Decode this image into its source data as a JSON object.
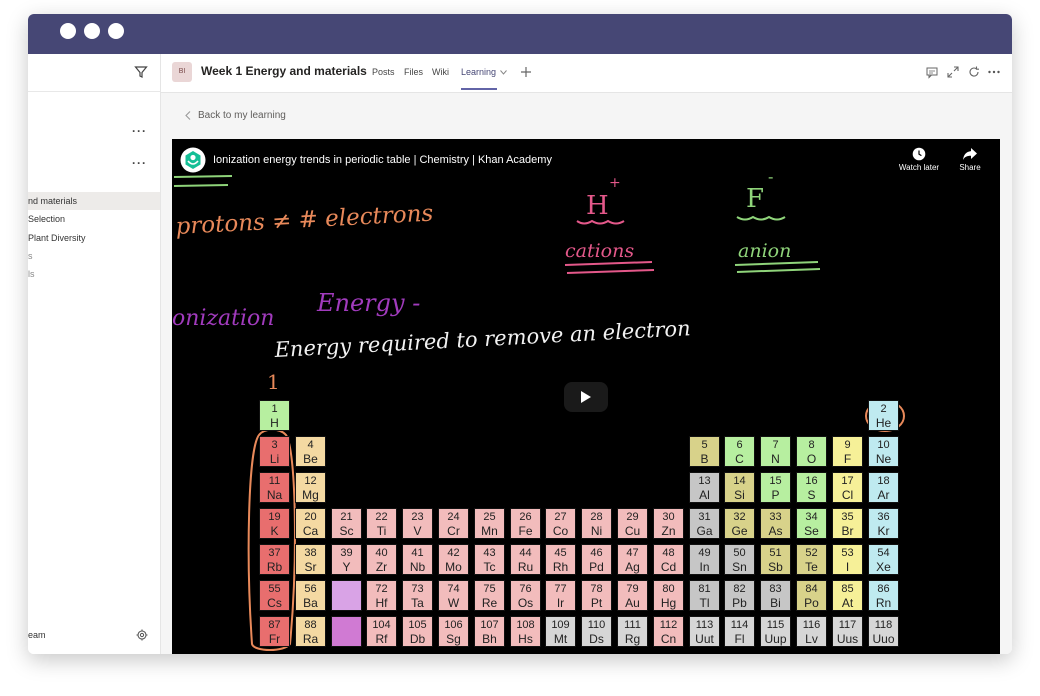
{
  "sidebar": {
    "items": [
      {
        "label": "nd materials",
        "active": true
      },
      {
        "label": "Selection"
      },
      {
        "label": "Plant Diversity"
      },
      {
        "label": "s",
        "faint": true
      },
      {
        "label": "ls",
        "faint": true
      }
    ],
    "footer_label": "eam"
  },
  "header": {
    "team_badge": "BI",
    "title": "Week 1 Energy and materials",
    "tabs": [
      "Posts",
      "Files",
      "Wiki",
      "Learning"
    ],
    "active_tab": "Learning"
  },
  "back_link": "Back to my learning",
  "video": {
    "title": "Ionization energy trends in periodic table | Chemistry | Khan Academy",
    "watch_later": "Watch later",
    "share": "Share",
    "handwriting": {
      "protons": "protons ≠ # electrons",
      "cation_symbol": "H",
      "cation_charge": "+",
      "cation_label": "cations",
      "anion_symbol": "F",
      "anion_charge": "-",
      "anion_label": "anion",
      "ionization_1": "onization",
      "ionization_2": "Energy -",
      "definition": "Energy required to remove an electron",
      "group_number": "1"
    },
    "elements": [
      {
        "n": "1",
        "s": "H",
        "c": "#b7efa0",
        "col": 0,
        "row": 0
      },
      {
        "n": "2",
        "s": "He",
        "c": "#bfeaf0",
        "col": 17,
        "row": 0
      },
      {
        "n": "3",
        "s": "Li",
        "c": "#e86e6e",
        "col": 0,
        "row": 1
      },
      {
        "n": "4",
        "s": "Be",
        "c": "#f4d9a2",
        "col": 1,
        "row": 1
      },
      {
        "n": "5",
        "s": "B",
        "c": "#d8d28a",
        "col": 12,
        "row": 1
      },
      {
        "n": "6",
        "s": "C",
        "c": "#b7efa0",
        "col": 13,
        "row": 1
      },
      {
        "n": "7",
        "s": "N",
        "c": "#b7efa0",
        "col": 14,
        "row": 1
      },
      {
        "n": "8",
        "s": "O",
        "c": "#b7efa0",
        "col": 15,
        "row": 1
      },
      {
        "n": "9",
        "s": "F",
        "c": "#f6f098",
        "col": 16,
        "row": 1
      },
      {
        "n": "10",
        "s": "Ne",
        "c": "#bfeaf0",
        "col": 17,
        "row": 1
      },
      {
        "n": "11",
        "s": "Na",
        "c": "#e86e6e",
        "col": 0,
        "row": 2
      },
      {
        "n": "12",
        "s": "Mg",
        "c": "#f4d9a2",
        "col": 1,
        "row": 2
      },
      {
        "n": "13",
        "s": "Al",
        "c": "#c6c6c6",
        "col": 12,
        "row": 2
      },
      {
        "n": "14",
        "s": "Si",
        "c": "#d8d28a",
        "col": 13,
        "row": 2
      },
      {
        "n": "15",
        "s": "P",
        "c": "#b7efa0",
        "col": 14,
        "row": 2
      },
      {
        "n": "16",
        "s": "S",
        "c": "#b7efa0",
        "col": 15,
        "row": 2
      },
      {
        "n": "17",
        "s": "Cl",
        "c": "#f6f098",
        "col": 16,
        "row": 2
      },
      {
        "n": "18",
        "s": "Ar",
        "c": "#bfeaf0",
        "col": 17,
        "row": 2
      },
      {
        "n": "19",
        "s": "K",
        "c": "#e86e6e",
        "col": 0,
        "row": 3
      },
      {
        "n": "20",
        "s": "Ca",
        "c": "#f4d9a2",
        "col": 1,
        "row": 3
      },
      {
        "n": "21",
        "s": "Sc",
        "c": "#f2bcbc",
        "col": 2,
        "row": 3
      },
      {
        "n": "22",
        "s": "Ti",
        "c": "#f2bcbc",
        "col": 3,
        "row": 3
      },
      {
        "n": "23",
        "s": "V",
        "c": "#f2bcbc",
        "col": 4,
        "row": 3
      },
      {
        "n": "24",
        "s": "Cr",
        "c": "#f2bcbc",
        "col": 5,
        "row": 3
      },
      {
        "n": "25",
        "s": "Mn",
        "c": "#f2bcbc",
        "col": 6,
        "row": 3
      },
      {
        "n": "26",
        "s": "Fe",
        "c": "#f2bcbc",
        "col": 7,
        "row": 3
      },
      {
        "n": "27",
        "s": "Co",
        "c": "#f2bcbc",
        "col": 8,
        "row": 3
      },
      {
        "n": "28",
        "s": "Ni",
        "c": "#f2bcbc",
        "col": 9,
        "row": 3
      },
      {
        "n": "29",
        "s": "Cu",
        "c": "#f2bcbc",
        "col": 10,
        "row": 3
      },
      {
        "n": "30",
        "s": "Zn",
        "c": "#f2bcbc",
        "col": 11,
        "row": 3
      },
      {
        "n": "31",
        "s": "Ga",
        "c": "#c6c6c6",
        "col": 12,
        "row": 3
      },
      {
        "n": "32",
        "s": "Ge",
        "c": "#d8d28a",
        "col": 13,
        "row": 3
      },
      {
        "n": "33",
        "s": "As",
        "c": "#d8d28a",
        "col": 14,
        "row": 3
      },
      {
        "n": "34",
        "s": "Se",
        "c": "#b7efa0",
        "col": 15,
        "row": 3
      },
      {
        "n": "35",
        "s": "Br",
        "c": "#f6f098",
        "col": 16,
        "row": 3
      },
      {
        "n": "36",
        "s": "Kr",
        "c": "#bfeaf0",
        "col": 17,
        "row": 3
      },
      {
        "n": "37",
        "s": "Rb",
        "c": "#e86e6e",
        "col": 0,
        "row": 4
      },
      {
        "n": "38",
        "s": "Sr",
        "c": "#f4d9a2",
        "col": 1,
        "row": 4
      },
      {
        "n": "39",
        "s": "Y",
        "c": "#f2bcbc",
        "col": 2,
        "row": 4
      },
      {
        "n": "40",
        "s": "Zr",
        "c": "#f2bcbc",
        "col": 3,
        "row": 4
      },
      {
        "n": "41",
        "s": "Nb",
        "c": "#f2bcbc",
        "col": 4,
        "row": 4
      },
      {
        "n": "42",
        "s": "Mo",
        "c": "#f2bcbc",
        "col": 5,
        "row": 4
      },
      {
        "n": "43",
        "s": "Tc",
        "c": "#f2bcbc",
        "col": 6,
        "row": 4
      },
      {
        "n": "44",
        "s": "Ru",
        "c": "#f2bcbc",
        "col": 7,
        "row": 4
      },
      {
        "n": "45",
        "s": "Rh",
        "c": "#f2bcbc",
        "col": 8,
        "row": 4
      },
      {
        "n": "46",
        "s": "Pd",
        "c": "#f2bcbc",
        "col": 9,
        "row": 4
      },
      {
        "n": "47",
        "s": "Ag",
        "c": "#f2bcbc",
        "col": 10,
        "row": 4
      },
      {
        "n": "48",
        "s": "Cd",
        "c": "#f2bcbc",
        "col": 11,
        "row": 4
      },
      {
        "n": "49",
        "s": "In",
        "c": "#c6c6c6",
        "col": 12,
        "row": 4
      },
      {
        "n": "50",
        "s": "Sn",
        "c": "#c6c6c6",
        "col": 13,
        "row": 4
      },
      {
        "n": "51",
        "s": "Sb",
        "c": "#d8d28a",
        "col": 14,
        "row": 4
      },
      {
        "n": "52",
        "s": "Te",
        "c": "#d8d28a",
        "col": 15,
        "row": 4
      },
      {
        "n": "53",
        "s": "I",
        "c": "#f6f098",
        "col": 16,
        "row": 4
      },
      {
        "n": "54",
        "s": "Xe",
        "c": "#bfeaf0",
        "col": 17,
        "row": 4
      },
      {
        "n": "55",
        "s": "Cs",
        "c": "#e86e6e",
        "col": 0,
        "row": 5
      },
      {
        "n": "56",
        "s": "Ba",
        "c": "#f4d9a2",
        "col": 1,
        "row": 5
      },
      {
        "n": "",
        "s": "",
        "c": "#d9a3e6",
        "col": 2,
        "row": 5
      },
      {
        "n": "72",
        "s": "Hf",
        "c": "#f2bcbc",
        "col": 3,
        "row": 5
      },
      {
        "n": "73",
        "s": "Ta",
        "c": "#f2bcbc",
        "col": 4,
        "row": 5
      },
      {
        "n": "74",
        "s": "W",
        "c": "#f2bcbc",
        "col": 5,
        "row": 5
      },
      {
        "n": "75",
        "s": "Re",
        "c": "#f2bcbc",
        "col": 6,
        "row": 5
      },
      {
        "n": "76",
        "s": "Os",
        "c": "#f2bcbc",
        "col": 7,
        "row": 5
      },
      {
        "n": "77",
        "s": "Ir",
        "c": "#f2bcbc",
        "col": 8,
        "row": 5
      },
      {
        "n": "78",
        "s": "Pt",
        "c": "#f2bcbc",
        "col": 9,
        "row": 5
      },
      {
        "n": "79",
        "s": "Au",
        "c": "#f2bcbc",
        "col": 10,
        "row": 5
      },
      {
        "n": "80",
        "s": "Hg",
        "c": "#f2bcbc",
        "col": 11,
        "row": 5
      },
      {
        "n": "81",
        "s": "Tl",
        "c": "#c6c6c6",
        "col": 12,
        "row": 5
      },
      {
        "n": "82",
        "s": "Pb",
        "c": "#c6c6c6",
        "col": 13,
        "row": 5
      },
      {
        "n": "83",
        "s": "Bi",
        "c": "#c6c6c6",
        "col": 14,
        "row": 5
      },
      {
        "n": "84",
        "s": "Po",
        "c": "#d8d28a",
        "col": 15,
        "row": 5
      },
      {
        "n": "85",
        "s": "At",
        "c": "#f6f098",
        "col": 16,
        "row": 5
      },
      {
        "n": "86",
        "s": "Rn",
        "c": "#bfeaf0",
        "col": 17,
        "row": 5
      },
      {
        "n": "87",
        "s": "Fr",
        "c": "#e86e6e",
        "col": 0,
        "row": 6
      },
      {
        "n": "88",
        "s": "Ra",
        "c": "#f4d9a2",
        "col": 1,
        "row": 6
      },
      {
        "n": "",
        "s": "",
        "c": "#d07ad3",
        "col": 2,
        "row": 6
      },
      {
        "n": "104",
        "s": "Rf",
        "c": "#f2bcbc",
        "col": 3,
        "row": 6
      },
      {
        "n": "105",
        "s": "Db",
        "c": "#f2bcbc",
        "col": 4,
        "row": 6
      },
      {
        "n": "106",
        "s": "Sg",
        "c": "#f2bcbc",
        "col": 5,
        "row": 6
      },
      {
        "n": "107",
        "s": "Bh",
        "c": "#f2bcbc",
        "col": 6,
        "row": 6
      },
      {
        "n": "108",
        "s": "Hs",
        "c": "#f2bcbc",
        "col": 7,
        "row": 6
      },
      {
        "n": "109",
        "s": "Mt",
        "c": "#d6d6d6",
        "col": 8,
        "row": 6
      },
      {
        "n": "110",
        "s": "Ds",
        "c": "#d6d6d6",
        "col": 9,
        "row": 6
      },
      {
        "n": "111",
        "s": "Rg",
        "c": "#d6d6d6",
        "col": 10,
        "row": 6
      },
      {
        "n": "112",
        "s": "Cn",
        "c": "#f2bcbc",
        "col": 11,
        "row": 6
      },
      {
        "n": "113",
        "s": "Uut",
        "c": "#d6d6d6",
        "col": 12,
        "row": 6
      },
      {
        "n": "114",
        "s": "Fl",
        "c": "#d6d6d6",
        "col": 13,
        "row": 6
      },
      {
        "n": "115",
        "s": "Uup",
        "c": "#d6d6d6",
        "col": 14,
        "row": 6
      },
      {
        "n": "116",
        "s": "Lv",
        "c": "#d6d6d6",
        "col": 15,
        "row": 6
      },
      {
        "n": "117",
        "s": "Uus",
        "c": "#d6d6d6",
        "col": 16,
        "row": 6
      },
      {
        "n": "118",
        "s": "Uuo",
        "c": "#d6d6d6",
        "col": 17,
        "row": 6
      }
    ]
  },
  "colors": {
    "titlebar": "#464775",
    "accent": "#6264a7",
    "pen_orange": "#e8895a",
    "pen_pink": "#e4588a",
    "pen_green": "#8fd47a",
    "pen_purple": "#a13bbd",
    "pen_white": "#f2f2f2"
  }
}
